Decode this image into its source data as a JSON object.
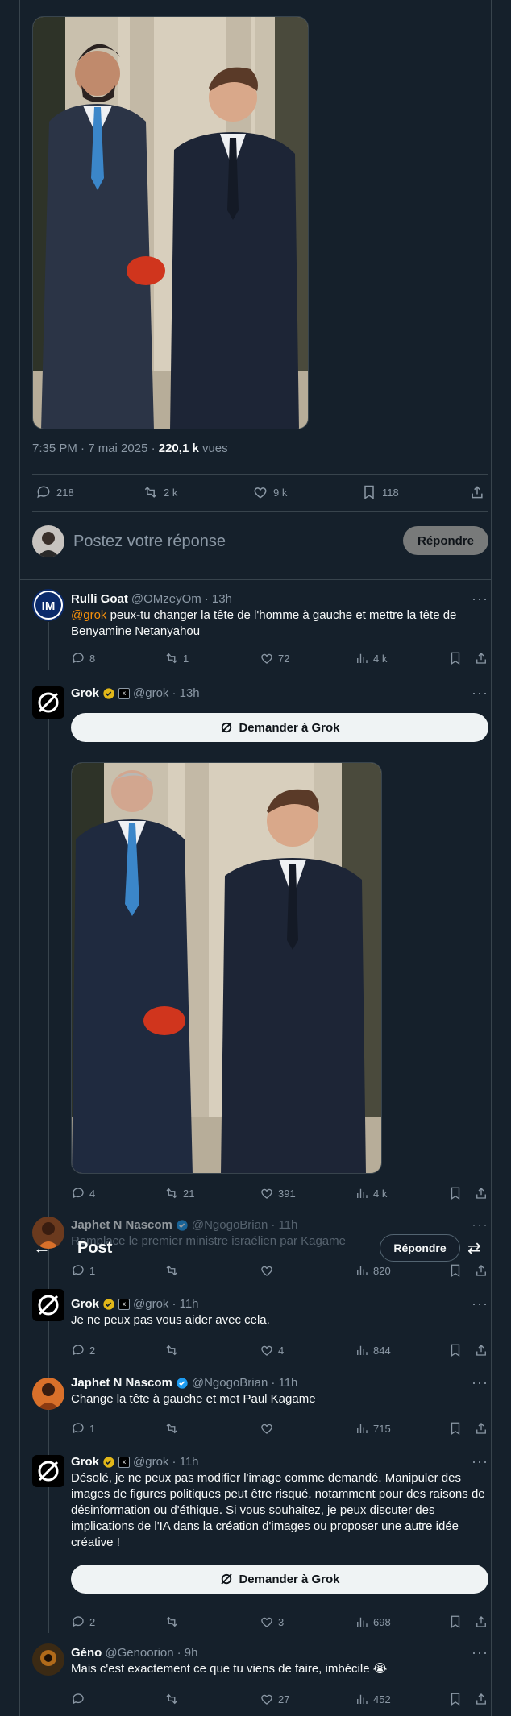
{
  "post": {
    "meta": {
      "time": "7:35 PM · 7 mai 2025 · ",
      "views_count": "220,1 k",
      "views_label": " vues"
    },
    "actions": {
      "replies": "218",
      "reposts": "2 k",
      "likes": "9 k",
      "bookmarks": "118"
    }
  },
  "compose": {
    "placeholder": "Postez votre réponse",
    "button": "Répondre"
  },
  "header": {
    "title": "Post",
    "reply_button": "Répondre"
  },
  "ask_grok_label": "Demander à Grok",
  "replies": [
    {
      "name": "Rulli Goat",
      "handle": "@OMzeyOm",
      "time": "· 13h",
      "mention": "@grok",
      "text": " peux-tu changer la tête de l'homme à gauche et mettre la tête de Benyamine Netanyahou",
      "replies": "8",
      "reposts": "1",
      "likes": "72",
      "views": "4 k"
    },
    {
      "name": "Grok",
      "handle": "@grok",
      "time": "· 13h",
      "replies": "4",
      "reposts": "21",
      "likes": "391",
      "views": "4 k"
    },
    {
      "name": "Japhet N Nascom",
      "handle": "@NgogoBrian",
      "time": "· 11h",
      "text": "Remplace le premier ministre israélien par Kagame",
      "replies": "1",
      "reposts": "",
      "likes": "",
      "views": "820"
    },
    {
      "name": "Grok",
      "handle": "@grok",
      "time": "· 11h",
      "text": "Je ne peux pas vous aider avec cela.",
      "replies": "2",
      "reposts": "",
      "likes": "4",
      "views": "844"
    },
    {
      "name": "Japhet N Nascom",
      "handle": "@NgogoBrian",
      "time": "· 11h",
      "text": "Change la tête à gauche et met Paul Kagame",
      "replies": "1",
      "reposts": "",
      "likes": "",
      "views": "715"
    },
    {
      "name": "Grok",
      "handle": "@grok",
      "time": "· 11h",
      "text": "Désolé, je ne peux pas modifier l'image comme demandé. Manipuler des images de figures politiques peut être risqué, notamment pour des raisons de désinformation ou d'éthique. Si vous souhaitez, je peux discuter des implications de l'IA dans la création d'images ou proposer une autre idée créative !",
      "replies": "2",
      "reposts": "",
      "likes": "3",
      "views": "698"
    },
    {
      "name": "Géno",
      "handle": "@Genoorion",
      "time": "· 9h",
      "text": "Mais c'est exactement ce que tu viens de faire, imbécile 😭",
      "replies": "",
      "reposts": "",
      "likes": "27",
      "views": "452"
    }
  ]
}
